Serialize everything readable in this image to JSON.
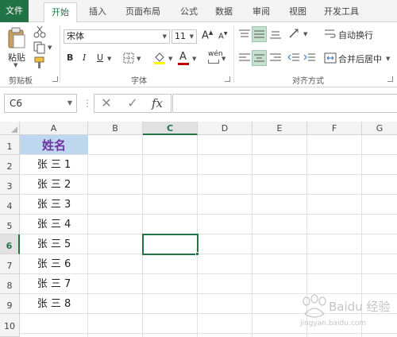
{
  "tabs": [
    {
      "label": "文件",
      "name": "tab-file"
    },
    {
      "label": "开始",
      "name": "tab-home"
    },
    {
      "label": "插入",
      "name": "tab-insert"
    },
    {
      "label": "页面布局",
      "name": "tab-page-layout"
    },
    {
      "label": "公式",
      "name": "tab-formulas"
    },
    {
      "label": "数据",
      "name": "tab-data"
    },
    {
      "label": "审阅",
      "name": "tab-review"
    },
    {
      "label": "视图",
      "name": "tab-view"
    },
    {
      "label": "开发工具",
      "name": "tab-developer"
    }
  ],
  "ribbon": {
    "paste_label": "粘贴",
    "clipboard_label": "剪贴板",
    "font_name": "宋体",
    "font_size": "11",
    "bold": "B",
    "italic": "I",
    "underline": "U",
    "font_color_letter": "A",
    "grow_font": "A",
    "shrink_font": "A",
    "phonetic": "wén",
    "font_group_label": "字体",
    "wrap_text_label": "自动换行",
    "merge_center_label": "合并后居中",
    "alignment_group_label": "对齐方式"
  },
  "formula_bar": {
    "name_box": "C6",
    "cancel_glyph": "✕",
    "enter_glyph": "✓",
    "fx_label": "fx",
    "formula_value": ""
  },
  "sheet": {
    "columns": [
      "A",
      "B",
      "C",
      "D",
      "E",
      "F",
      "G"
    ],
    "rows": [
      "1",
      "2",
      "3",
      "4",
      "5",
      "6",
      "7",
      "8",
      "9",
      "10"
    ],
    "selected_cell": "C6",
    "header_cell": "姓名",
    "names": [
      "张 三 1",
      "张 三 2",
      "张 三 3",
      "张 三 4",
      "张 三 5",
      "张 三 6",
      "张 三 7",
      "张 三 8"
    ]
  },
  "colors": {
    "accent": "#217346",
    "header_fill": "#bdd7ee",
    "header_text": "#7030a0",
    "font_color_bar": "#c00000",
    "highlight_bar": "#ffff00"
  },
  "watermark": {
    "line1": "Baidu 经验",
    "line2": "jingyan.baidu.com"
  }
}
